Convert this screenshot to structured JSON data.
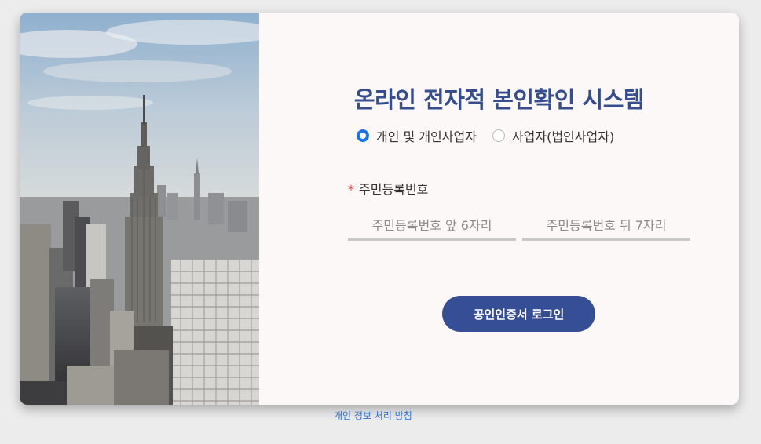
{
  "title": "온라인 전자적 본인확인 시스템",
  "user_type": {
    "options": [
      {
        "label": "개인 및 개인사업자",
        "checked": true
      },
      {
        "label": "사업자(법인사업자)",
        "checked": false
      }
    ]
  },
  "rrn_field": {
    "required_mark": "*",
    "label": "주민등록번호",
    "front_placeholder": "주민등록번호 앞 6자리",
    "back_placeholder": "주민등록번호 뒤 7자리",
    "front_value": "",
    "back_value": ""
  },
  "login_button_label": "공인인증서 로그인",
  "privacy_link_label": "개인 정보 처리 방침",
  "colors": {
    "accent": "#364e96",
    "radio_checked": "#1a73e8",
    "required": "#d33a3a",
    "link": "#2a6fd6"
  },
  "icons": [
    "city-skyline-photo",
    "radio-checked-icon",
    "radio-unchecked-icon"
  ]
}
